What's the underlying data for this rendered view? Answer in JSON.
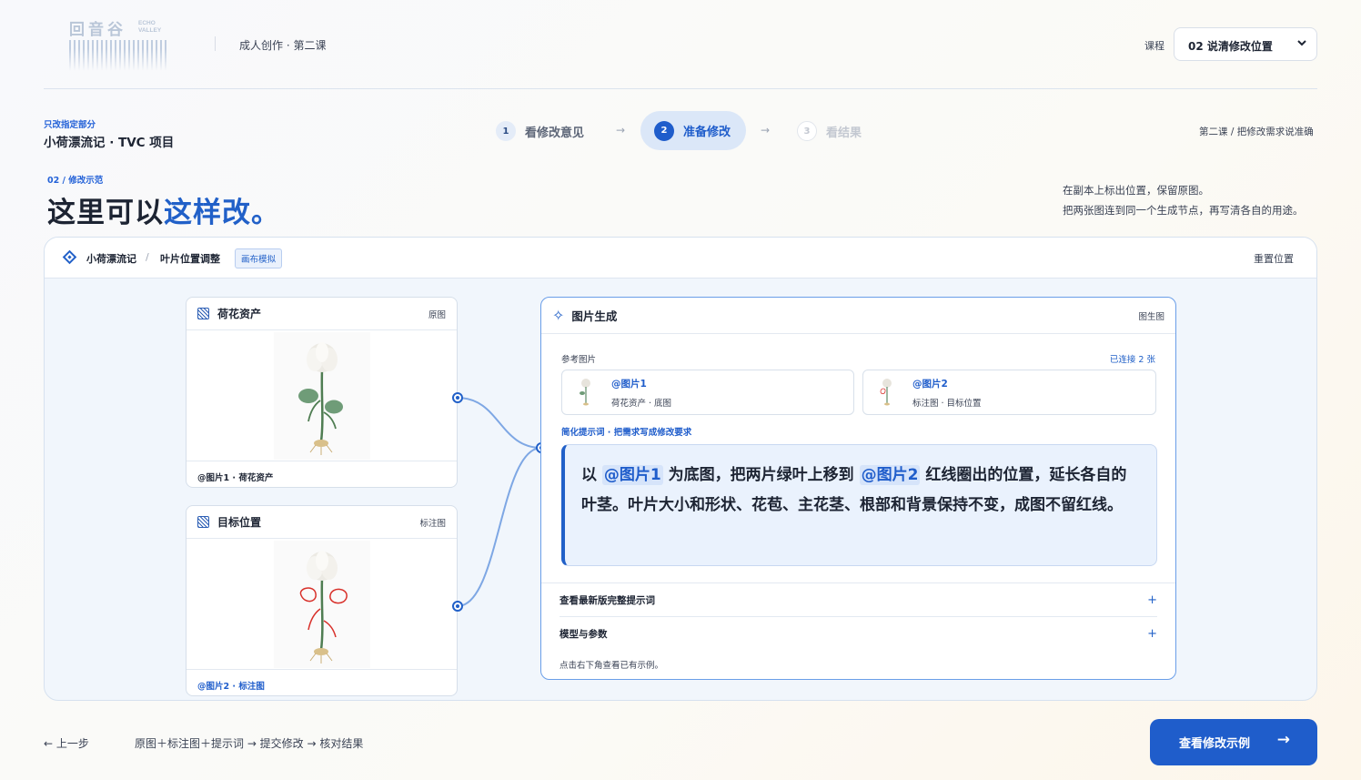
{
  "header": {
    "logo_cn": "回音谷",
    "logo_en_line1": "ECHO",
    "logo_en_line2": "VALLEY",
    "course_subtitle": "成人创作 · 第二课",
    "course_label": "课程",
    "course_selected": "02 说清修改位置"
  },
  "project": {
    "kicker": "只改指定部分",
    "title": "小荷漂流记 · TVC 项目"
  },
  "steps": [
    {
      "num": "1",
      "label": "看修改意见",
      "state": "done"
    },
    {
      "num": "2",
      "label": "准备修改",
      "state": "active"
    },
    {
      "num": "3",
      "label": "看结果",
      "state": "upcoming"
    }
  ],
  "step_arrow": "→",
  "lesson_note": "第二课 / 把修改需求说准确",
  "section": {
    "kicker": "02 / 修改示范",
    "headline_plain": "这里可以",
    "headline_highlight": "这样改。",
    "desc_line1": "在副本上标出位置，保留原图。",
    "desc_line2": "把两张图连到同一个生成节点，再写清各自的用途。"
  },
  "canvas": {
    "breadcrumb_project": "小荷漂流记",
    "breadcrumb_sep": "/",
    "breadcrumb_page": "叶片位置调整",
    "mode_badge": "画布模拟",
    "reset_label": "重置位置",
    "asset_card": {
      "title": "荷花资产",
      "tag": "原图",
      "footer": "@图片1 · 荷花资产"
    },
    "target_card": {
      "title": "目标位置",
      "tag": "标注图",
      "footer": "@图片2 · 标注图"
    },
    "gen_card": {
      "title": "图片生成",
      "tag": "图生图",
      "ref_label": "参考图片",
      "ref_count": "已连接 2 张",
      "refs": [
        {
          "title": "@图片1",
          "sub": "荷花资产 · 底图"
        },
        {
          "title": "@图片2",
          "sub": "标注图 · 目标位置"
        }
      ],
      "prompt_label": "简化提示词 · 把需求写成修改要求",
      "prompt": {
        "p1": "以 ",
        "m1": "@图片1",
        "p2": " 为底图，把两片绿叶上移到 ",
        "m2": "@图片2",
        "p3": " 红线圈出的位置，延长各自的叶茎。叶片大小和形状、花苞、主花茎、根部和背景保持不变，成图不留红线。"
      },
      "accordion1": "查看最新版完整提示词",
      "accordion2": "模型与参数",
      "accordion_icon": "+",
      "hint": "点击右下角查看已有示例。"
    }
  },
  "footer": {
    "back": "← 上一步",
    "flow": "原图＋标注图＋提示词 → 提交修改 → 核对结果",
    "cta": "查看修改示例",
    "cta_arrow": "→"
  },
  "colors": {
    "accent": "#1f5dcb",
    "annotation": "#d8302a",
    "leaf": "#5e8a68"
  }
}
